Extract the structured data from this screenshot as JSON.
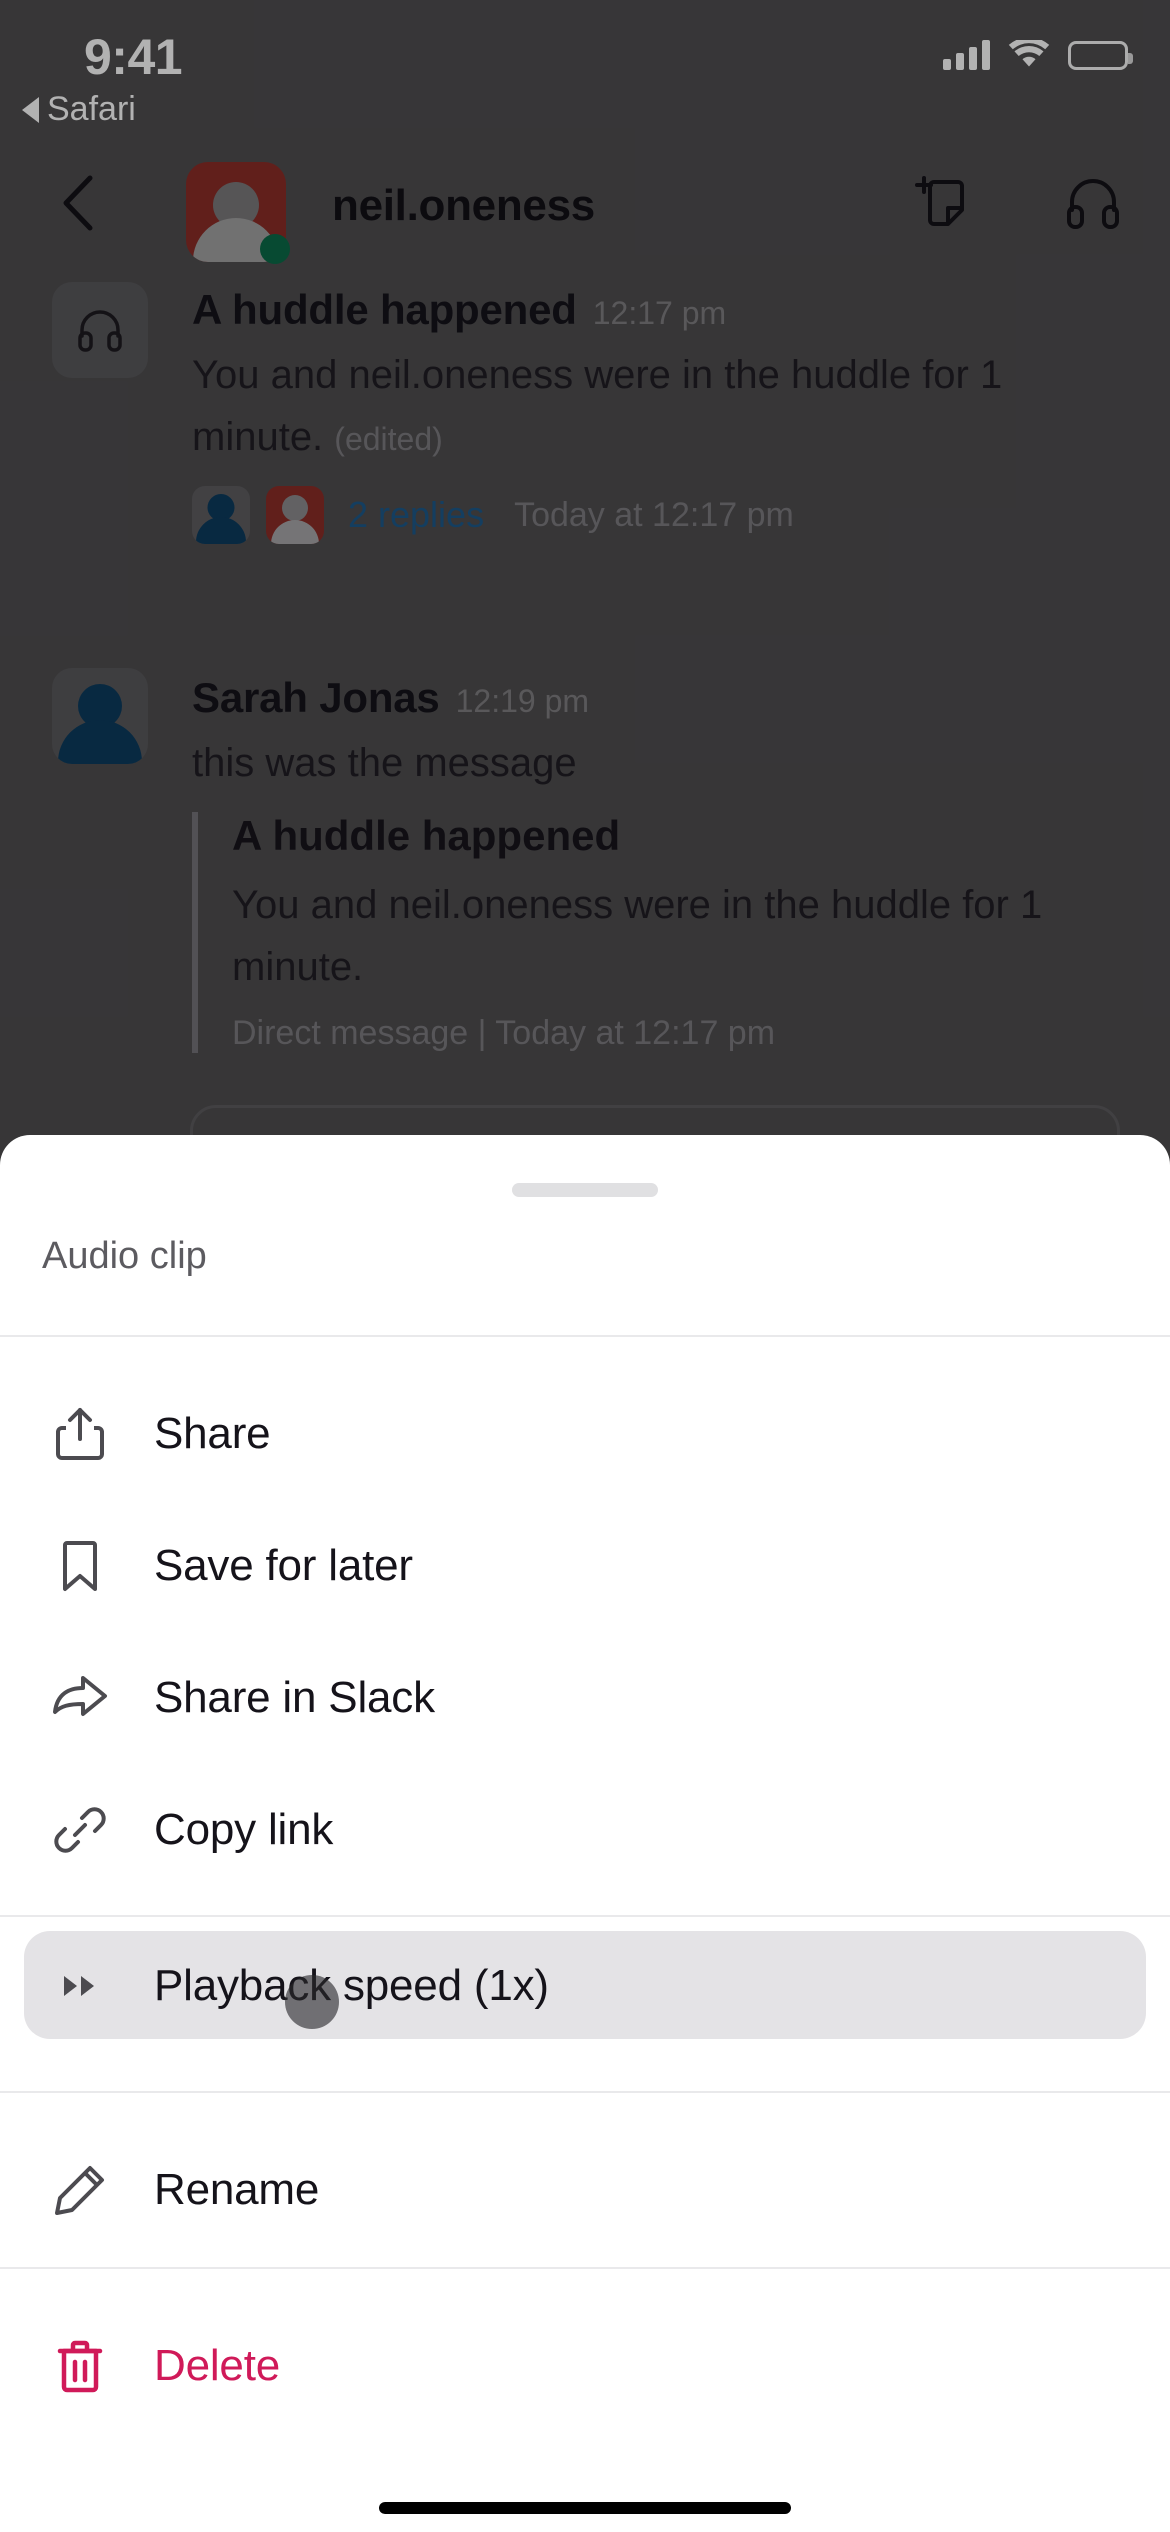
{
  "status_bar": {
    "time": "9:41",
    "back_app_label": "Safari",
    "signal_icon": "cellular-signal-icon",
    "wifi_icon": "wifi-icon",
    "battery_icon": "battery-full-icon"
  },
  "nav": {
    "back_icon": "chevron-left-icon",
    "avatar_name": "dm-avatar",
    "title": "neil.oneness",
    "presence": "online",
    "actions": [
      {
        "name": "add-canvas-icon"
      },
      {
        "name": "huddle-headphones-icon"
      }
    ]
  },
  "conversation": {
    "messages": [
      {
        "avatar_icon": "headphones-icon",
        "author": "A huddle happened",
        "time": "12:17 pm",
        "body": "You and neil.oneness were in the huddle for 1 minute.",
        "edited_label": "(edited)",
        "replies_count_label": "2 replies",
        "replies_time": "Today at 12:17 pm"
      },
      {
        "avatar_icon": "person-icon",
        "author": "Sarah Jonas",
        "time": "12:19 pm",
        "body": "this was the message"
      }
    ],
    "quote": {
      "title": "A huddle happened",
      "text": "You and neil.oneness were in the huddle for 1 minute.",
      "meta": "Direct message | Today at 12:17 pm"
    }
  },
  "action_sheet": {
    "title": "Audio clip",
    "handle": "sheet-grab-handle",
    "items": [
      {
        "label": "Share",
        "icon": "share-icon",
        "name": "share",
        "danger": false,
        "highlighted": false
      },
      {
        "label": "Save for later",
        "icon": "bookmark-icon",
        "name": "save-for-later",
        "danger": false,
        "highlighted": false
      },
      {
        "label": "Share in Slack",
        "icon": "forward-arrow-icon",
        "name": "share-in-slack",
        "danger": false,
        "highlighted": false
      },
      {
        "label": "Copy link",
        "icon": "link-icon",
        "name": "copy-link",
        "danger": false,
        "highlighted": false
      },
      {
        "label": "Playback speed (1x)",
        "icon": "fast-forward-icon",
        "name": "playback-speed",
        "danger": false,
        "highlighted": true
      },
      {
        "label": "Rename",
        "icon": "pencil-icon",
        "name": "rename",
        "danger": false,
        "highlighted": false
      },
      {
        "label": "Delete",
        "icon": "trash-icon",
        "name": "delete",
        "danger": true,
        "highlighted": false
      }
    ]
  },
  "colors": {
    "danger": "#d01a59",
    "link": "#1d5a8a",
    "avatar_red": "#8c2d28",
    "avatar_navy": "#0c3b5e",
    "presence_green": "#0b6b48",
    "highlight_bg": "#e4e3e6",
    "sheet_bg": "#ffffff",
    "scrim": "rgba(0,0,0,0.30)"
  },
  "home_indicator": "home-indicator"
}
